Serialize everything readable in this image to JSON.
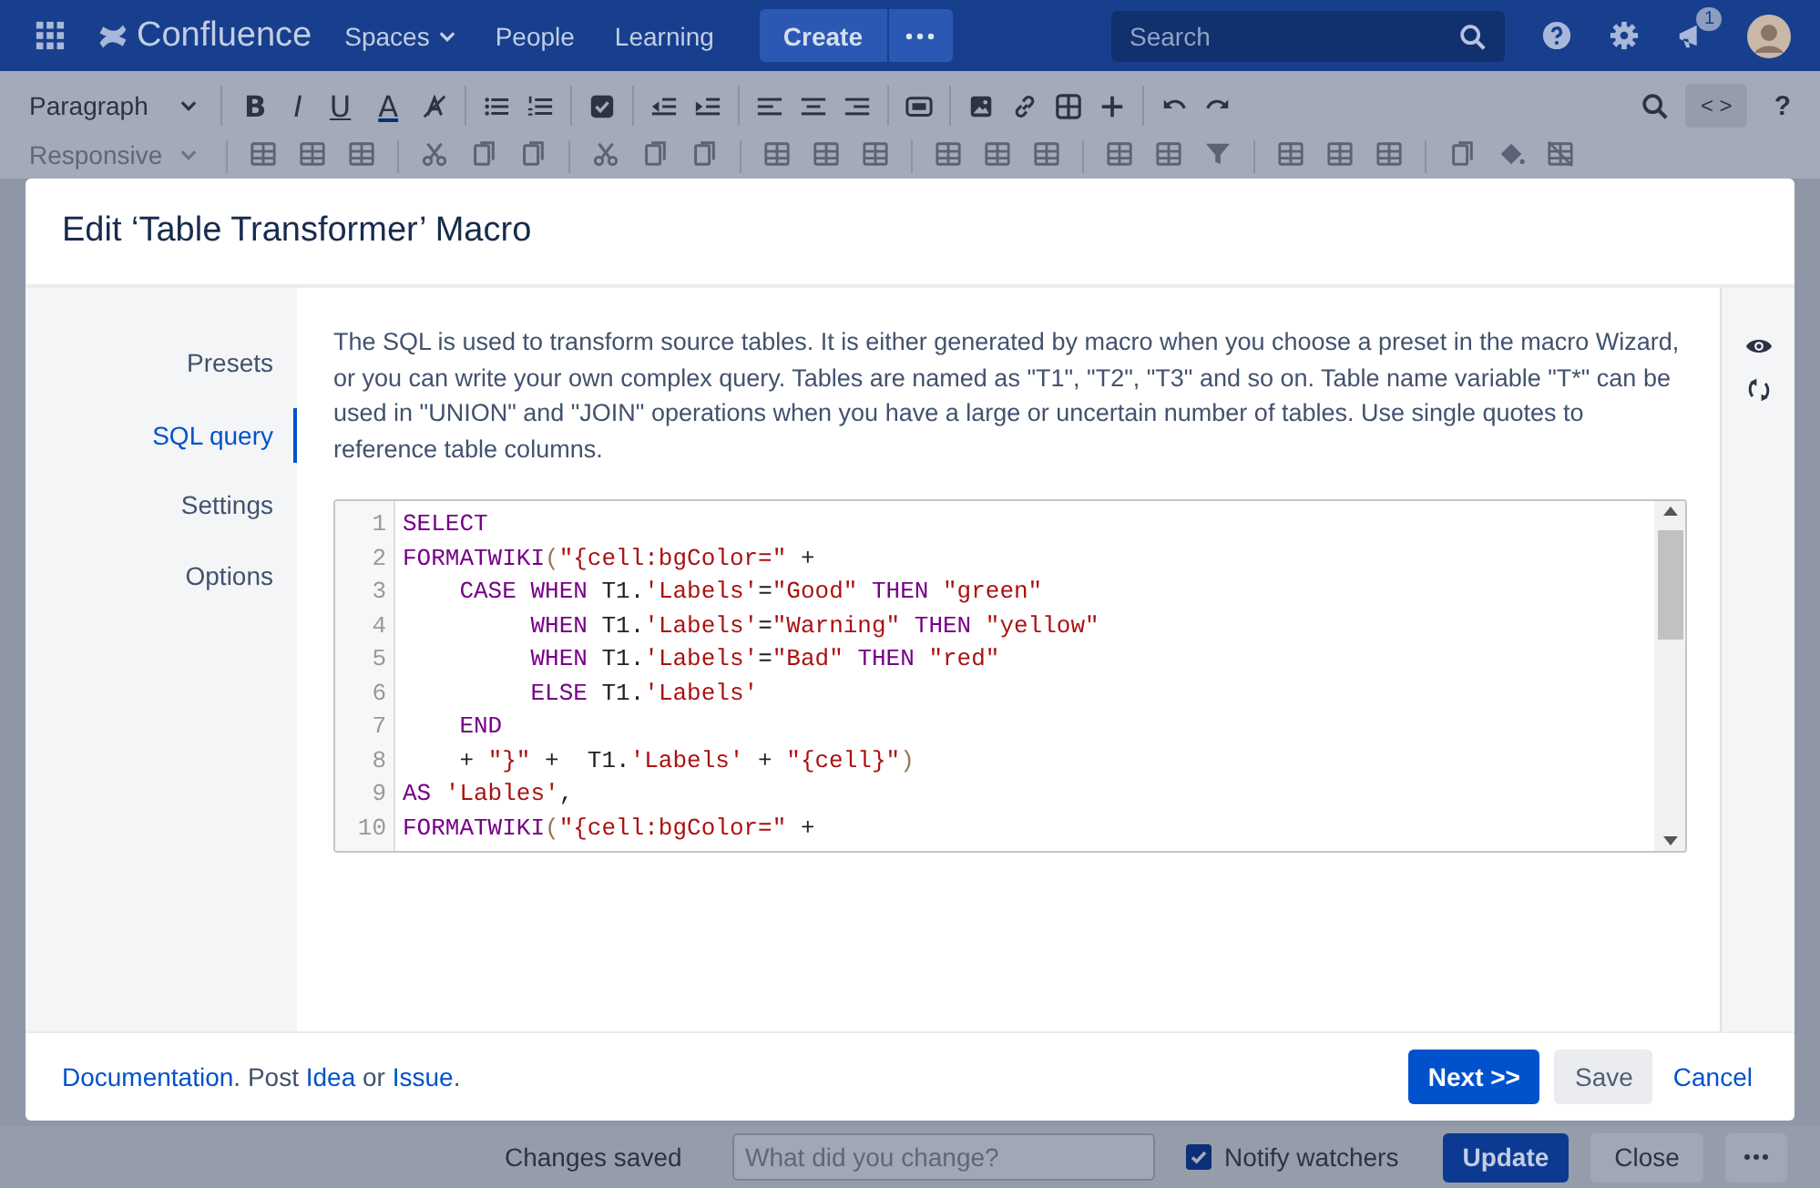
{
  "nav": {
    "product": "Confluence",
    "items": [
      {
        "label": "Spaces",
        "dropdown": true
      },
      {
        "label": "People",
        "dropdown": false
      },
      {
        "label": "Learning",
        "dropdown": false
      }
    ],
    "create": "Create",
    "search": {
      "placeholder": "Search"
    },
    "notification_count": "1"
  },
  "toolbar": {
    "style": "Paragraph",
    "format_buttons": [
      "B",
      "I",
      "U",
      "A"
    ],
    "width_mode": "Responsive",
    "source": "< >",
    "help": "?"
  },
  "dialog": {
    "title": "Edit ‘Table Transformer’ Macro",
    "nav": [
      {
        "label": "Presets",
        "selected": false
      },
      {
        "label": "SQL query",
        "selected": true
      },
      {
        "label": "Settings",
        "selected": false
      },
      {
        "label": "Options",
        "selected": false
      }
    ],
    "description": "The SQL is used to transform source tables. It is either generated by macro when you choose a preset in the macro Wizard, or you can write your own complex query. Tables are named as \"T1\", \"T2\", \"T3\" and so on. Table name variable \"T*\" can be used in \"UNION\" and \"JOIN\" operations when you have a large or uncertain number of tables. Use single quotes to reference table columns.",
    "code": [
      {
        "number": "1",
        "tokens": [
          {
            "kind": "keyword",
            "text": "SELECT"
          }
        ]
      },
      {
        "number": "2",
        "tokens": [
          {
            "kind": "keyword",
            "text": "FORMATWIKI"
          },
          {
            "kind": "bracket",
            "text": "("
          },
          {
            "kind": "string",
            "text": "\"{cell:bgColor=\""
          },
          {
            "kind": "plain",
            "text": " +"
          }
        ]
      },
      {
        "number": "3",
        "tokens": [
          {
            "kind": "keyword",
            "text": "    CASE WHEN"
          },
          {
            "kind": "plain",
            "text": " T1."
          },
          {
            "kind": "string",
            "text": "'Labels'"
          },
          {
            "kind": "plain",
            "text": "="
          },
          {
            "kind": "string",
            "text": "\"Good\" "
          },
          {
            "kind": "keyword",
            "text": "THEN "
          },
          {
            "kind": "string",
            "text": "\"green\""
          }
        ]
      },
      {
        "number": "4",
        "tokens": [
          {
            "kind": "keyword",
            "text": "         WHEN"
          },
          {
            "kind": "plain",
            "text": " T1."
          },
          {
            "kind": "string",
            "text": "'Labels'"
          },
          {
            "kind": "plain",
            "text": "="
          },
          {
            "kind": "string",
            "text": "\"Warning\" "
          },
          {
            "kind": "keyword",
            "text": "THEN "
          },
          {
            "kind": "string",
            "text": "\"yellow\""
          }
        ]
      },
      {
        "number": "5",
        "tokens": [
          {
            "kind": "keyword",
            "text": "         WHEN"
          },
          {
            "kind": "plain",
            "text": " T1."
          },
          {
            "kind": "string",
            "text": "'Labels'"
          },
          {
            "kind": "plain",
            "text": "="
          },
          {
            "kind": "string",
            "text": "\"Bad\" "
          },
          {
            "kind": "keyword",
            "text": "THEN "
          },
          {
            "kind": "string",
            "text": "\"red\""
          }
        ]
      },
      {
        "number": "6",
        "tokens": [
          {
            "kind": "keyword",
            "text": "         ELSE"
          },
          {
            "kind": "plain",
            "text": " T1."
          },
          {
            "kind": "string",
            "text": "'Labels'"
          }
        ]
      },
      {
        "number": "7",
        "tokens": [
          {
            "kind": "keyword",
            "text": "    END"
          }
        ]
      },
      {
        "number": "8",
        "tokens": [
          {
            "kind": "plain",
            "text": "    + "
          },
          {
            "kind": "string",
            "text": "\"}\""
          },
          {
            "kind": "plain",
            "text": " +  T1."
          },
          {
            "kind": "string",
            "text": "'Labels'"
          },
          {
            "kind": "plain",
            "text": " + "
          },
          {
            "kind": "string",
            "text": "\"{cell}\""
          },
          {
            "kind": "bracket",
            "text": ")"
          }
        ]
      },
      {
        "number": "9",
        "tokens": [
          {
            "kind": "keyword",
            "text": "AS "
          },
          {
            "kind": "string",
            "text": "'Lables'"
          },
          {
            "kind": "plain",
            "text": ","
          }
        ]
      },
      {
        "number": "10",
        "tokens": [
          {
            "kind": "keyword",
            "text": "FORMATWIKI"
          },
          {
            "kind": "bracket",
            "text": "("
          },
          {
            "kind": "string",
            "text": "\"{cell:bgColor=\""
          },
          {
            "kind": "plain",
            "text": " +"
          }
        ]
      }
    ],
    "footer": {
      "note": [
        {
          "kind": "link",
          "text": "Documentation"
        },
        {
          "kind": "text",
          "text": ". Post "
        },
        {
          "kind": "link",
          "text": "Idea"
        },
        {
          "kind": "text",
          "text": " or "
        },
        {
          "kind": "link",
          "text": "Issue"
        },
        {
          "kind": "text",
          "text": "."
        }
      ],
      "next": "Next >>",
      "save": "Save",
      "cancel": "Cancel"
    }
  },
  "bottom_bar": {
    "status": "Changes saved",
    "comment": {
      "placeholder": "What did you change?"
    },
    "notify": {
      "label": "Notify watchers",
      "checked": true
    },
    "update": "Update",
    "close": "Close"
  }
}
